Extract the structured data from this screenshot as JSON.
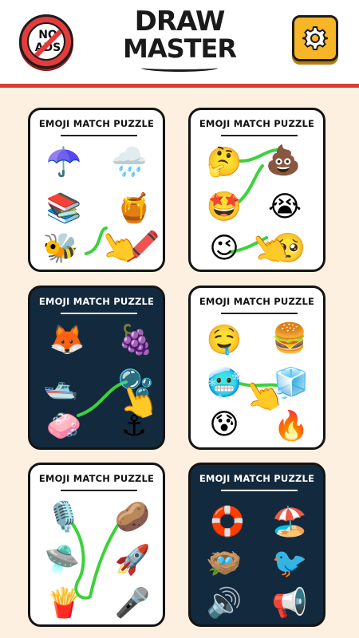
{
  "header": {
    "no_ads_label": "NO\nADS",
    "logo_line1": "DRAW",
    "logo_line2": "MASTER",
    "accent_color": "#e03a33",
    "settings_icon": "gear-icon"
  },
  "cards": [
    {
      "title": "EMOJI MATCH PUZZLE",
      "theme": "light",
      "items": [
        "☂️",
        "🌧️",
        "📚",
        "🍯",
        "🐝",
        "🖍️"
      ],
      "hand": "👆"
    },
    {
      "title": "EMOJI MATCH PUZZLE",
      "theme": "light",
      "items": [
        "🤔",
        "💩",
        "🤩",
        "😭",
        "😉",
        "🥺"
      ],
      "hand": "👆"
    },
    {
      "title": "EMOJI MATCH PUZZLE",
      "theme": "dark",
      "items": [
        "🦊",
        "🍇",
        "🛥️",
        "🫧",
        "🧼",
        "⚓"
      ],
      "hand": "👆"
    },
    {
      "title": "EMOJI MATCH PUZZLE",
      "theme": "light",
      "items": [
        "🤤",
        "🍔",
        "🥶",
        "🧊",
        "😰",
        "🔥"
      ],
      "hand": "👆"
    },
    {
      "title": "EMOJI MATCH PUZZLE",
      "theme": "light",
      "items": [
        "🎙️",
        "🥔",
        "🛸",
        "🚀",
        "🍟",
        "🎤"
      ],
      "hand": ""
    },
    {
      "title": "EMOJI MATCH PUZZLE",
      "theme": "dark",
      "items": [
        "🛟",
        "🏖️",
        "🪺",
        "🐦",
        "🔊",
        "📢"
      ],
      "hand": ""
    }
  ]
}
